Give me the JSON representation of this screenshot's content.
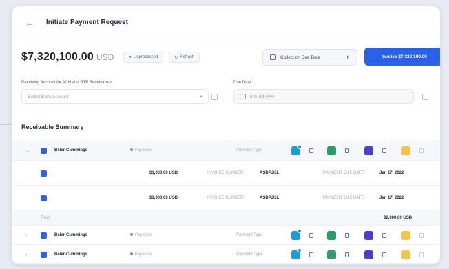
{
  "header": {
    "title": "Initiate Payment Request"
  },
  "summary": {
    "amount": "$7,320,100.00",
    "currency": "USD",
    "status_pill": "Unprocessed",
    "refresh_label": "Refresh",
    "collect_label": "Collect on Due Date",
    "invoice_label": "Invoice $7,320,100.00"
  },
  "form": {
    "account_label": "Receiving Account for ACH and RTP Receivables",
    "account_placeholder": "Select Bank Account",
    "due_date_label": "Due Date",
    "due_date_placeholder": "mm-dd-yyyy"
  },
  "receivables": {
    "title": "Receivable Summary",
    "payment_type_label": "Payment Type",
    "total_label": "Total",
    "total_value": "$2,000.00 USD",
    "groups": [
      {
        "name": "Beier-Cummings",
        "status": "Payables"
      },
      {
        "name": "Beier-Cummings",
        "status": "Payables"
      },
      {
        "name": "Beier-Cummings",
        "status": "Payables"
      }
    ],
    "lines": [
      {
        "amount": "$1,000.00 USD",
        "invoice_label": "INVOICE NUMBER",
        "invoice": "ASDPJKL",
        "due_label": "PAYMENT DUE DATE",
        "due": "Jan 17, 2022"
      },
      {
        "amount": "$1,000.00 USD",
        "invoice_label": "INVOICE NUMBER",
        "invoice": "ASDPJKL",
        "due_label": "PAYMENT DUE DATE",
        "due": "Jan 17, 2022"
      }
    ]
  },
  "colors": {
    "primary": "#2962e8",
    "teal": "#1f9bd6",
    "green": "#2e9c6a",
    "purple": "#4a3fc9",
    "yellow": "#f4c44a"
  }
}
